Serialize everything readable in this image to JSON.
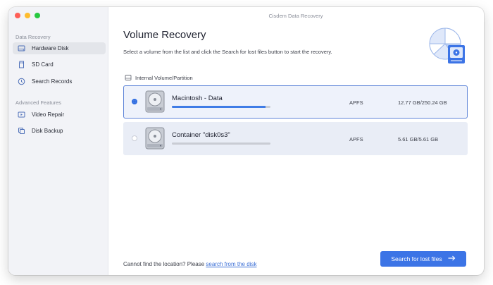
{
  "window": {
    "title": "Cisdem Data Recovery"
  },
  "sidebar": {
    "sections": [
      {
        "label": "Data Recovery",
        "items": [
          {
            "label": "Hardware Disk",
            "icon": "hard-disk-icon",
            "active": true
          },
          {
            "label": "SD Card",
            "icon": "sd-card-icon",
            "active": false
          },
          {
            "label": "Search Records",
            "icon": "clock-icon",
            "active": false
          }
        ]
      },
      {
        "label": "Advanced Features",
        "items": [
          {
            "label": "Video Repair",
            "icon": "video-icon",
            "active": false
          },
          {
            "label": "Disk Backup",
            "icon": "backup-icon",
            "active": false
          }
        ]
      }
    ]
  },
  "main": {
    "title": "Volume Recovery",
    "subtitle": "Select a volume from the list and click the Search for lost files button to start the recovery.",
    "group_label": "Internal Volume/Partition",
    "volumes": [
      {
        "name": "Macintosh - Data",
        "filesystem": "APFS",
        "size": "12.77 GB/250.24 GB",
        "selected": true,
        "usage_fraction": 0.95
      },
      {
        "name": "Container \"disk0s3\"",
        "filesystem": "APFS",
        "size": "5.61 GB/5.61 GB",
        "selected": false,
        "usage_fraction": 0.0
      }
    ],
    "footer": {
      "text": "Cannot find the location? Please ",
      "link": "search from the disk"
    },
    "primary_button": {
      "label": "Search for lost files",
      "icon": "arrow-right-icon"
    }
  },
  "colors": {
    "accent": "#3c74e6",
    "sidebar_bg": "#f2f3f7",
    "selected_row_bg": "#eef2fb",
    "selected_row_border": "#5f85d8",
    "traffic_close": "#fe5f57",
    "traffic_minimize": "#febc2e",
    "traffic_zoom": "#28c840"
  }
}
